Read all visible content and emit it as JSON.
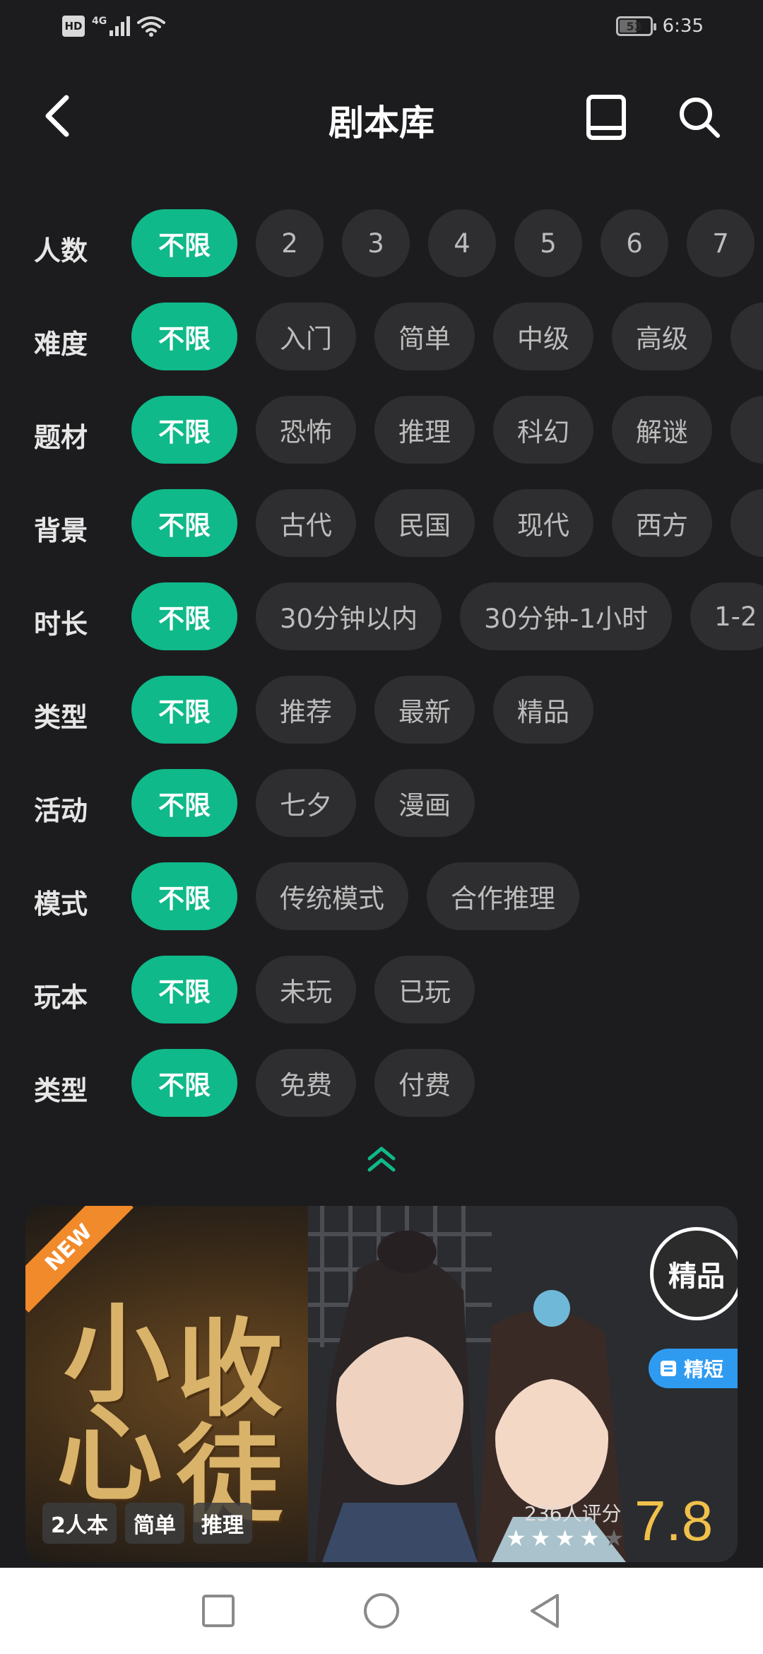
{
  "status_bar": {
    "hd_label": "HD",
    "network": "4G",
    "battery_level": "53",
    "time": "6:35"
  },
  "header": {
    "title": "剧本库",
    "back_icon": "chevron-left-icon",
    "book_icon": "book-icon",
    "search_icon": "search-icon"
  },
  "filters": [
    {
      "label": "人数",
      "active": "不限",
      "options": [
        "2",
        "3",
        "4",
        "5",
        "6",
        "7"
      ]
    },
    {
      "label": "难度",
      "active": "不限",
      "options": [
        "入门",
        "简单",
        "中级",
        "高级",
        ""
      ]
    },
    {
      "label": "题材",
      "active": "不限",
      "options": [
        "恐怖",
        "推理",
        "科幻",
        "解谜",
        ""
      ]
    },
    {
      "label": "背景",
      "active": "不限",
      "options": [
        "古代",
        "民国",
        "现代",
        "西方",
        ""
      ]
    },
    {
      "label": "时长",
      "active": "不限",
      "options": [
        "30分钟以内",
        "30分钟-1小时",
        "1-2"
      ]
    },
    {
      "label": "类型",
      "active": "不限",
      "options": [
        "推荐",
        "最新",
        "精品"
      ]
    },
    {
      "label": "活动",
      "active": "不限",
      "options": [
        "七夕",
        "漫画"
      ]
    },
    {
      "label": "模式",
      "active": "不限",
      "options": [
        "传统模式",
        "合作推理"
      ]
    },
    {
      "label": "玩本",
      "active": "不限",
      "options": [
        "未玩",
        "已玩"
      ]
    },
    {
      "label": "类型",
      "active": "不限",
      "options": [
        "免费",
        "付费"
      ]
    }
  ],
  "collapse_icon": "double-chevron-up-icon",
  "banner": {
    "ribbon": "NEW",
    "title_chars": [
      "小",
      "心",
      "收",
      "徒"
    ],
    "premium_badge": "精品",
    "short_badge": "精短",
    "tags": [
      "2人本",
      "简单",
      "推理"
    ],
    "rating_count": "236人评分",
    "score": "7.8",
    "stars_value": 3.5,
    "stars_max": 5
  },
  "nav_bar": {
    "recent_icon": "square-icon",
    "home_icon": "circle-icon",
    "back_icon": "triangle-back-icon"
  },
  "colors": {
    "accent": "#0fb98a",
    "background": "#1c1c1e",
    "chip": "#2e2e30",
    "score": "#f0c04a",
    "ribbon": "#f18a2a",
    "short_badge": "#2f9bf0"
  }
}
